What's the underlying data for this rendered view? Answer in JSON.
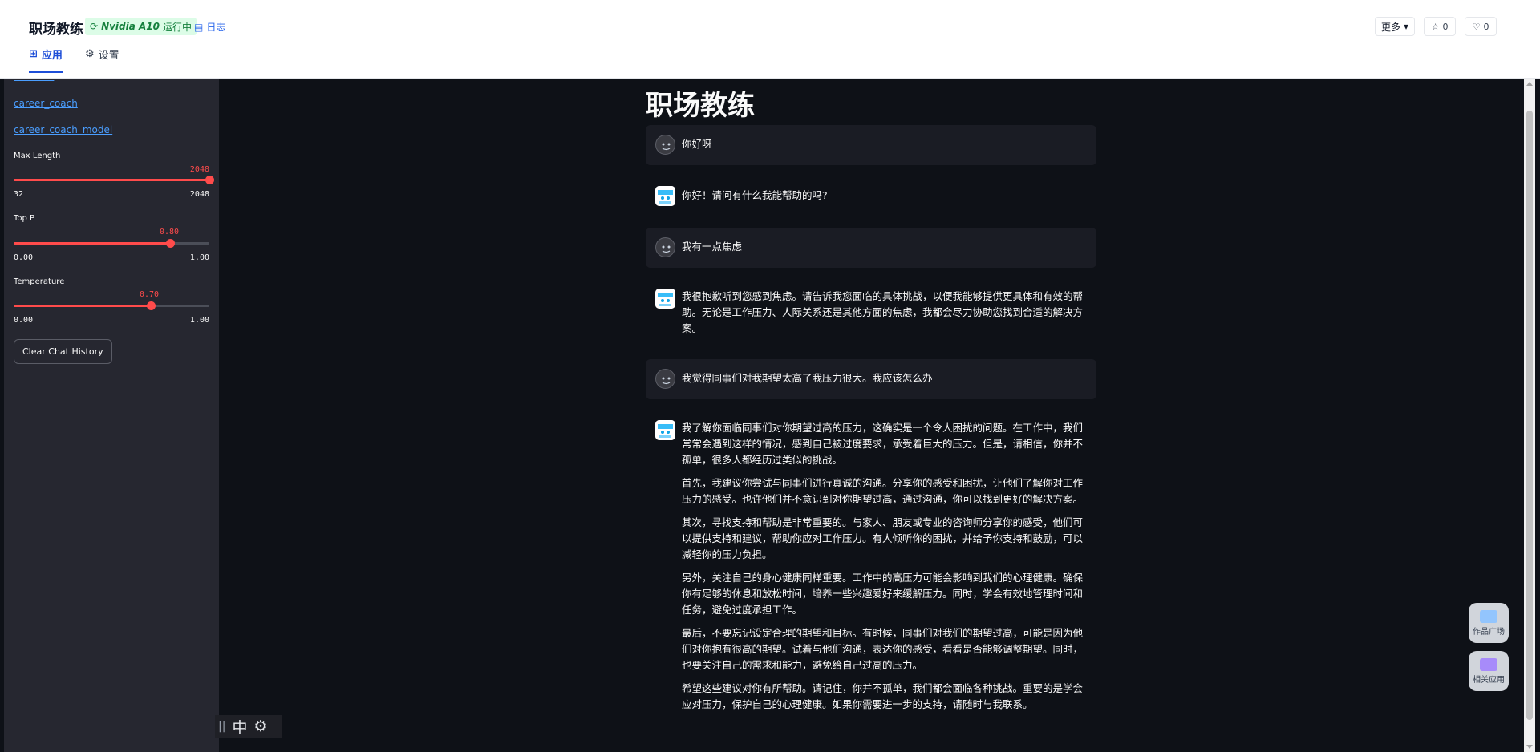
{
  "header": {
    "title": "职场教练",
    "gpu_label": "Nvidia A10",
    "status": "运行中",
    "log_label": "日志",
    "tabs": [
      {
        "label": "应用"
      },
      {
        "label": "设置"
      }
    ],
    "more_label": "更多",
    "star_count": "0",
    "like_count": "0"
  },
  "sidebar": {
    "links": [
      "internlm",
      "career_coach",
      "career_coach_model"
    ],
    "sliders": [
      {
        "label": "Max Length",
        "value": "2048",
        "min": "32",
        "max": "2048",
        "fraction": 1.0
      },
      {
        "label": "Top P",
        "value": "0.80",
        "min": "0.00",
        "max": "1.00",
        "fraction": 0.8
      },
      {
        "label": "Temperature",
        "value": "0.70",
        "min": "0.00",
        "max": "1.00",
        "fraction": 0.7
      }
    ],
    "clear_button": "Clear Chat History"
  },
  "bottom_tools": {
    "lang": "中"
  },
  "main": {
    "title": "职场教练",
    "messages": [
      {
        "role": "user",
        "paragraphs": [
          "你好呀"
        ]
      },
      {
        "role": "assistant",
        "paragraphs": [
          "你好！请问有什么我能帮助的吗?"
        ]
      },
      {
        "role": "user",
        "paragraphs": [
          "我有一点焦虑"
        ]
      },
      {
        "role": "assistant",
        "paragraphs": [
          "我很抱歉听到您感到焦虑。请告诉我您面临的具体挑战，以便我能够提供更具体和有效的帮助。无论是工作压力、人际关系还是其他方面的焦虑，我都会尽力协助您找到合适的解决方案。"
        ]
      },
      {
        "role": "user",
        "paragraphs": [
          "我觉得同事们对我期望太高了我压力很大。我应该怎么办"
        ]
      },
      {
        "role": "assistant",
        "paragraphs": [
          "我了解你面临同事们对你期望过高的压力，这确实是一个令人困扰的问题。在工作中，我们常常会遇到这样的情况，感到自己被过度要求，承受着巨大的压力。但是，请相信，你并不孤单，很多人都经历过类似的挑战。",
          "首先，我建议你尝试与同事们进行真诚的沟通。分享你的感受和困扰，让他们了解你对工作压力的感受。也许他们并不意识到对你期望过高，通过沟通，你可以找到更好的解决方案。",
          "其次，寻找支持和帮助是非常重要的。与家人、朋友或专业的咨询师分享你的感受，他们可以提供支持和建议，帮助你应对工作压力。有人倾听你的困扰，并给予你支持和鼓励，可以减轻你的压力负担。",
          "另外，关注自己的身心健康同样重要。工作中的高压力可能会影响到我们的心理健康。确保你有足够的休息和放松时间，培养一些兴趣爱好来缓解压力。同时，学会有效地管理时间和任务，避免过度承担工作。",
          "最后，不要忘记设定合理的期望和目标。有时候，同事们对我们的期望过高，可能是因为他们对你抱有很高的期望。试着与他们沟通，表达你的感受，看看是否能够调整期望。同时，也要关注自己的需求和能力，避免给自己过高的压力。",
          "希望这些建议对你有所帮助。请记住，你并不孤单，我们都会面临各种挑战。重要的是学会应对压力，保护自己的心理健康。如果你需要进一步的支持，请随时与我联系。"
        ]
      }
    ]
  },
  "floating": {
    "gallery_label": "作品广场",
    "related_label": "相关应用"
  },
  "colors": {
    "accent": "#ff4b4b",
    "link": "#4a9eff",
    "status_bg": "#dcfce7",
    "tab_active": "#1d4ed8"
  }
}
